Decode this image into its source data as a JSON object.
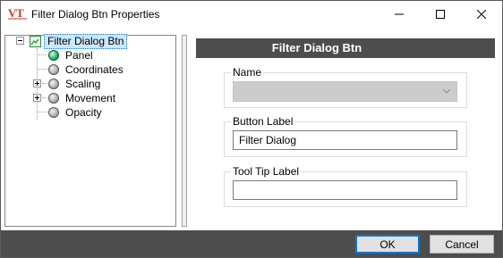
{
  "window": {
    "title": "Filter Dialog Btn Properties",
    "icon": "vt-app-icon",
    "controls": [
      "minimize-icon",
      "maximize-icon",
      "close-icon"
    ]
  },
  "tree": {
    "root": {
      "label": "Filter Dialog Btn",
      "expanded": true,
      "selected": true,
      "icon": "picture-icon"
    },
    "children": [
      {
        "label": "Panel",
        "icon": "green-ball-icon",
        "expandable": false
      },
      {
        "label": "Coordinates",
        "icon": "grey-ball-icon",
        "expandable": false
      },
      {
        "label": "Scaling",
        "icon": "grey-ball-icon",
        "expandable": true
      },
      {
        "label": "Movement",
        "icon": "grey-ball-icon",
        "expandable": true
      },
      {
        "label": "Opacity",
        "icon": "grey-ball-icon",
        "expandable": false
      }
    ]
  },
  "panel": {
    "header": "Filter Dialog Btn",
    "name_group": {
      "title": "Name",
      "value": ""
    },
    "button_label_group": {
      "title": "Button Label",
      "value": "Filter Dialog"
    },
    "tooltip_group": {
      "title": "Tool Tip Label",
      "value": ""
    }
  },
  "footer": {
    "ok_label": "OK",
    "cancel_label": "Cancel"
  },
  "colors": {
    "dark_bar": "#4d4d4d",
    "selection": "#cce8ff",
    "focus": "#0078d7",
    "disabled_field": "#cccccc"
  }
}
